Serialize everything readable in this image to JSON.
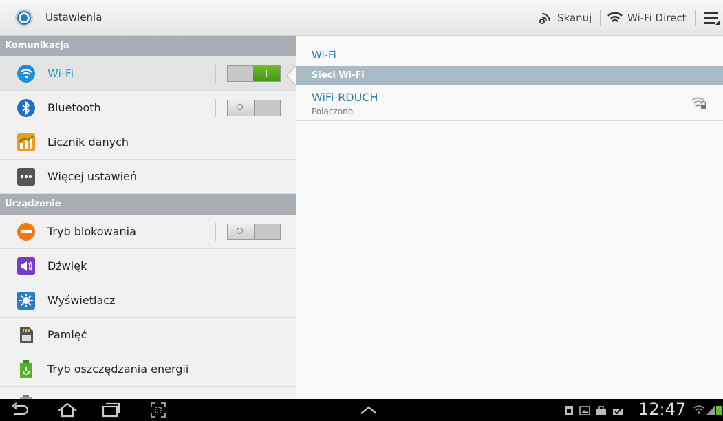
{
  "header": {
    "app_title": "Ustawienia",
    "scan_label": "Skanuj",
    "wifi_direct_label": "Wi-Fi Direct"
  },
  "sidebar": {
    "sections": [
      {
        "title": "Komunikacja",
        "items": [
          {
            "label": "Wi-Fi",
            "icon": "wifi-icon",
            "toggle": "on",
            "active": true
          },
          {
            "label": "Bluetooth",
            "icon": "bluetooth-icon",
            "toggle": "off"
          },
          {
            "label": "Licznik danych",
            "icon": "data-usage-icon"
          },
          {
            "label": "Więcej ustawień",
            "icon": "more-settings-icon"
          }
        ]
      },
      {
        "title": "Urządzenie",
        "items": [
          {
            "label": "Tryb blokowania",
            "icon": "blocking-mode-icon",
            "toggle": "off"
          },
          {
            "label": "Dźwięk",
            "icon": "sound-icon"
          },
          {
            "label": "Wyświetlacz",
            "icon": "display-icon"
          },
          {
            "label": "Pamięć",
            "icon": "storage-icon"
          },
          {
            "label": "Tryb oszczędzania energii",
            "icon": "power-saving-icon"
          }
        ]
      }
    ]
  },
  "detail": {
    "title": "Wi-Fi",
    "section_title": "Sieci Wi-Fi",
    "networks": [
      {
        "name": "WiFi-RDUCH",
        "status": "Połączono",
        "icon": "wifi-secured-signal-icon"
      }
    ]
  },
  "system_bar": {
    "time": "12:47"
  },
  "colors": {
    "accent": "#2a9bd4",
    "toggle_on": "#4ca817",
    "section_bg": "#a9aeb4"
  }
}
